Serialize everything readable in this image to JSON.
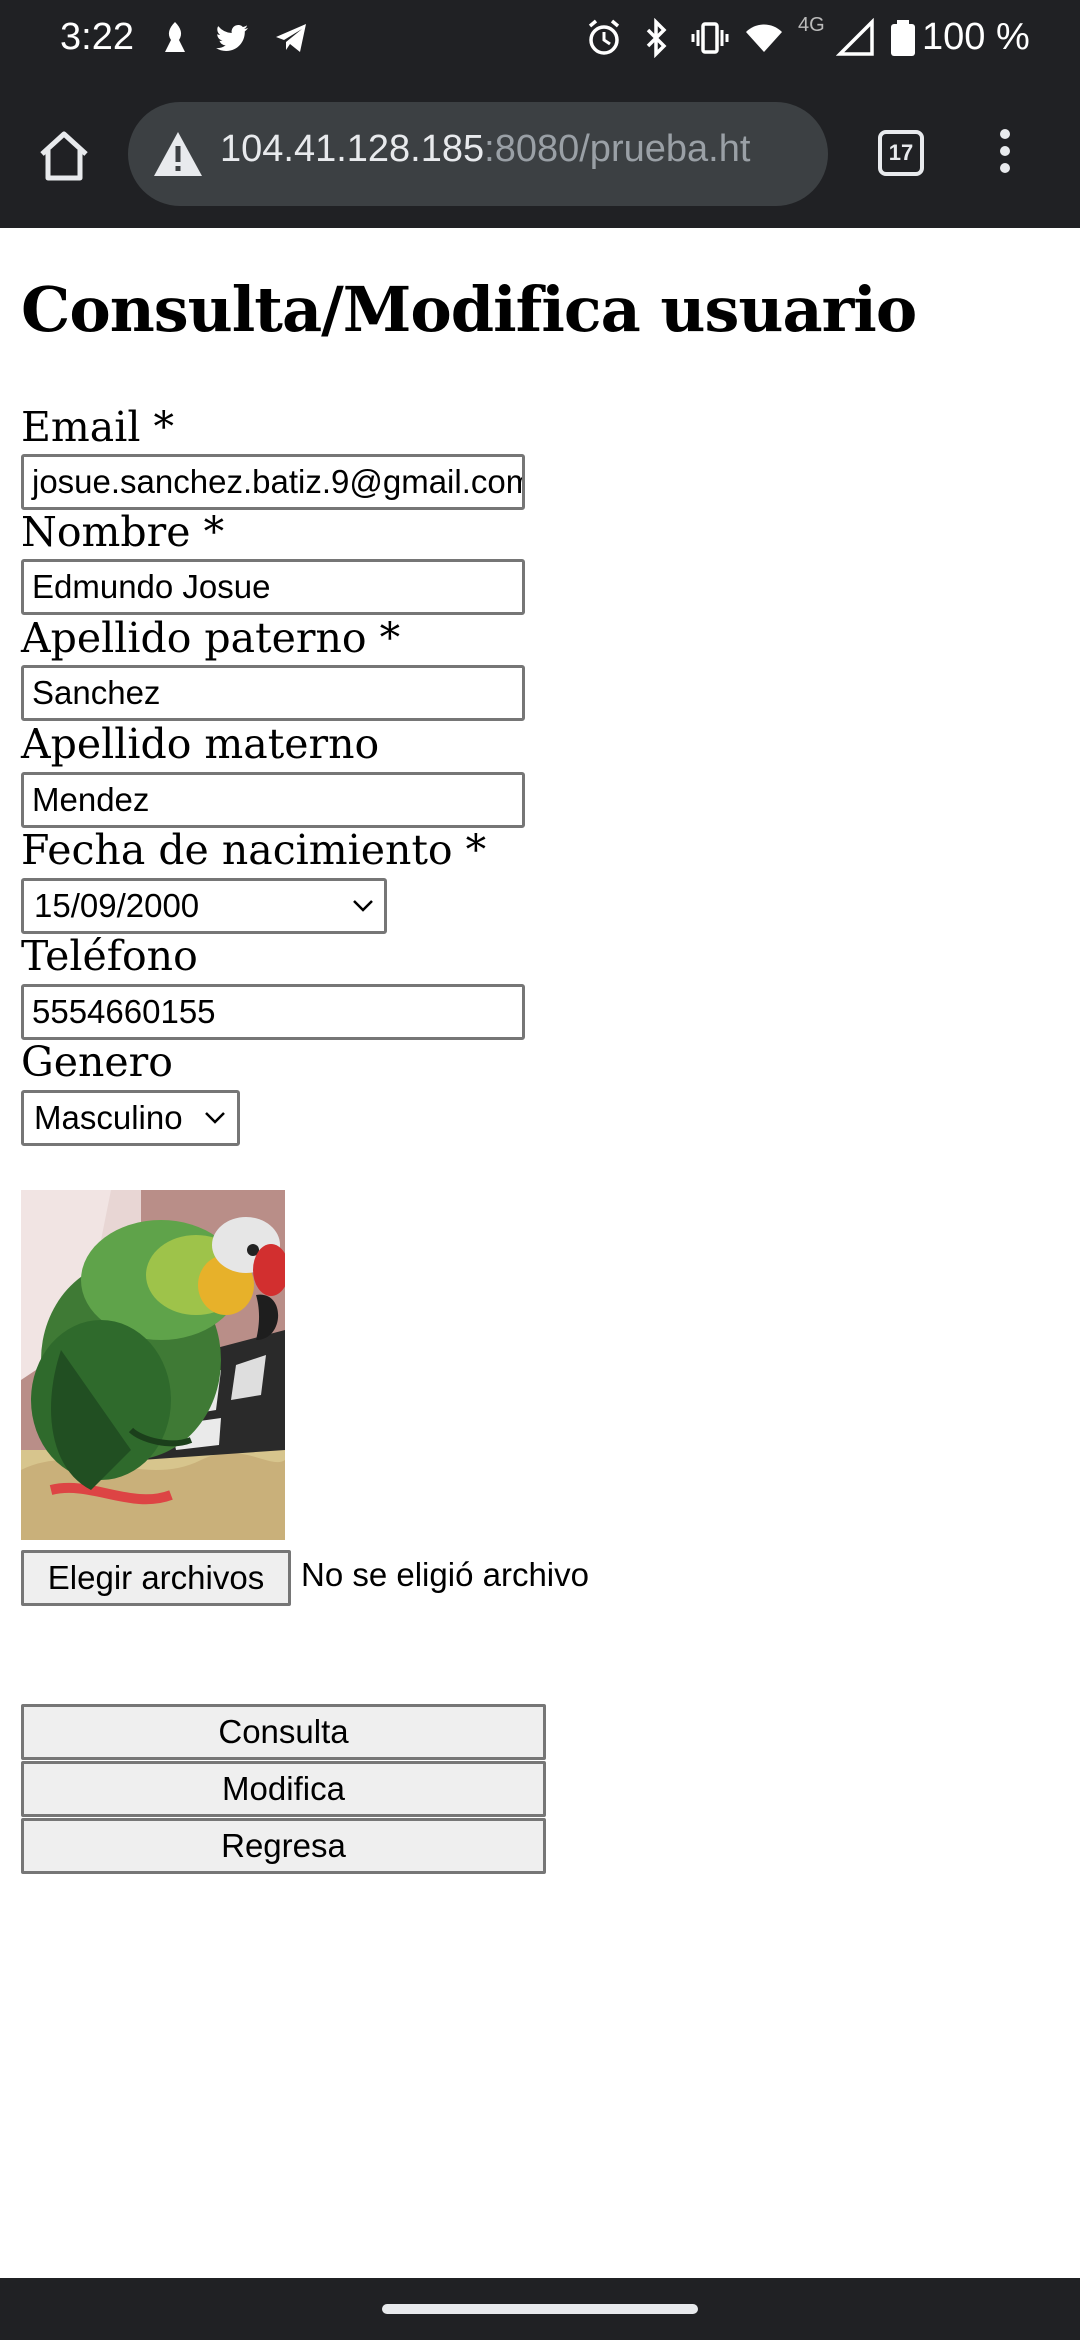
{
  "status_bar": {
    "time": "3:22",
    "network": "4G",
    "battery": "100 %"
  },
  "browser": {
    "url_host": "104.41.128.185",
    "url_rest": ":8080/prueba.ht",
    "tab_count": "17"
  },
  "page": {
    "title": "Consulta/Modifica usuario",
    "fields": {
      "email": {
        "label": "Email *",
        "value": "josue.sanchez.batiz.9@gmail.com"
      },
      "nombre": {
        "label": "Nombre *",
        "value": "Edmundo Josue"
      },
      "apellido_paterno": {
        "label": "Apellido paterno *",
        "value": "Sanchez"
      },
      "apellido_materno": {
        "label": "Apellido materno",
        "value": "Mendez"
      },
      "fecha_nacimiento": {
        "label": "Fecha de nacimiento *",
        "value": "15/09/2000"
      },
      "telefono": {
        "label": "Teléfono",
        "value": "5554660155"
      },
      "genero": {
        "label": "Genero",
        "value": "Masculino"
      }
    },
    "file_input": {
      "button_label": "Elegir archivos",
      "status": "No se eligió archivo"
    },
    "buttons": {
      "consulta": "Consulta",
      "modifica": "Modifica",
      "regresa": "Regresa"
    }
  },
  "colors": {
    "chrome_dark": "#202124",
    "url_bar": "#3c4043",
    "button_bg": "#efefef",
    "input_border": "#767676"
  }
}
